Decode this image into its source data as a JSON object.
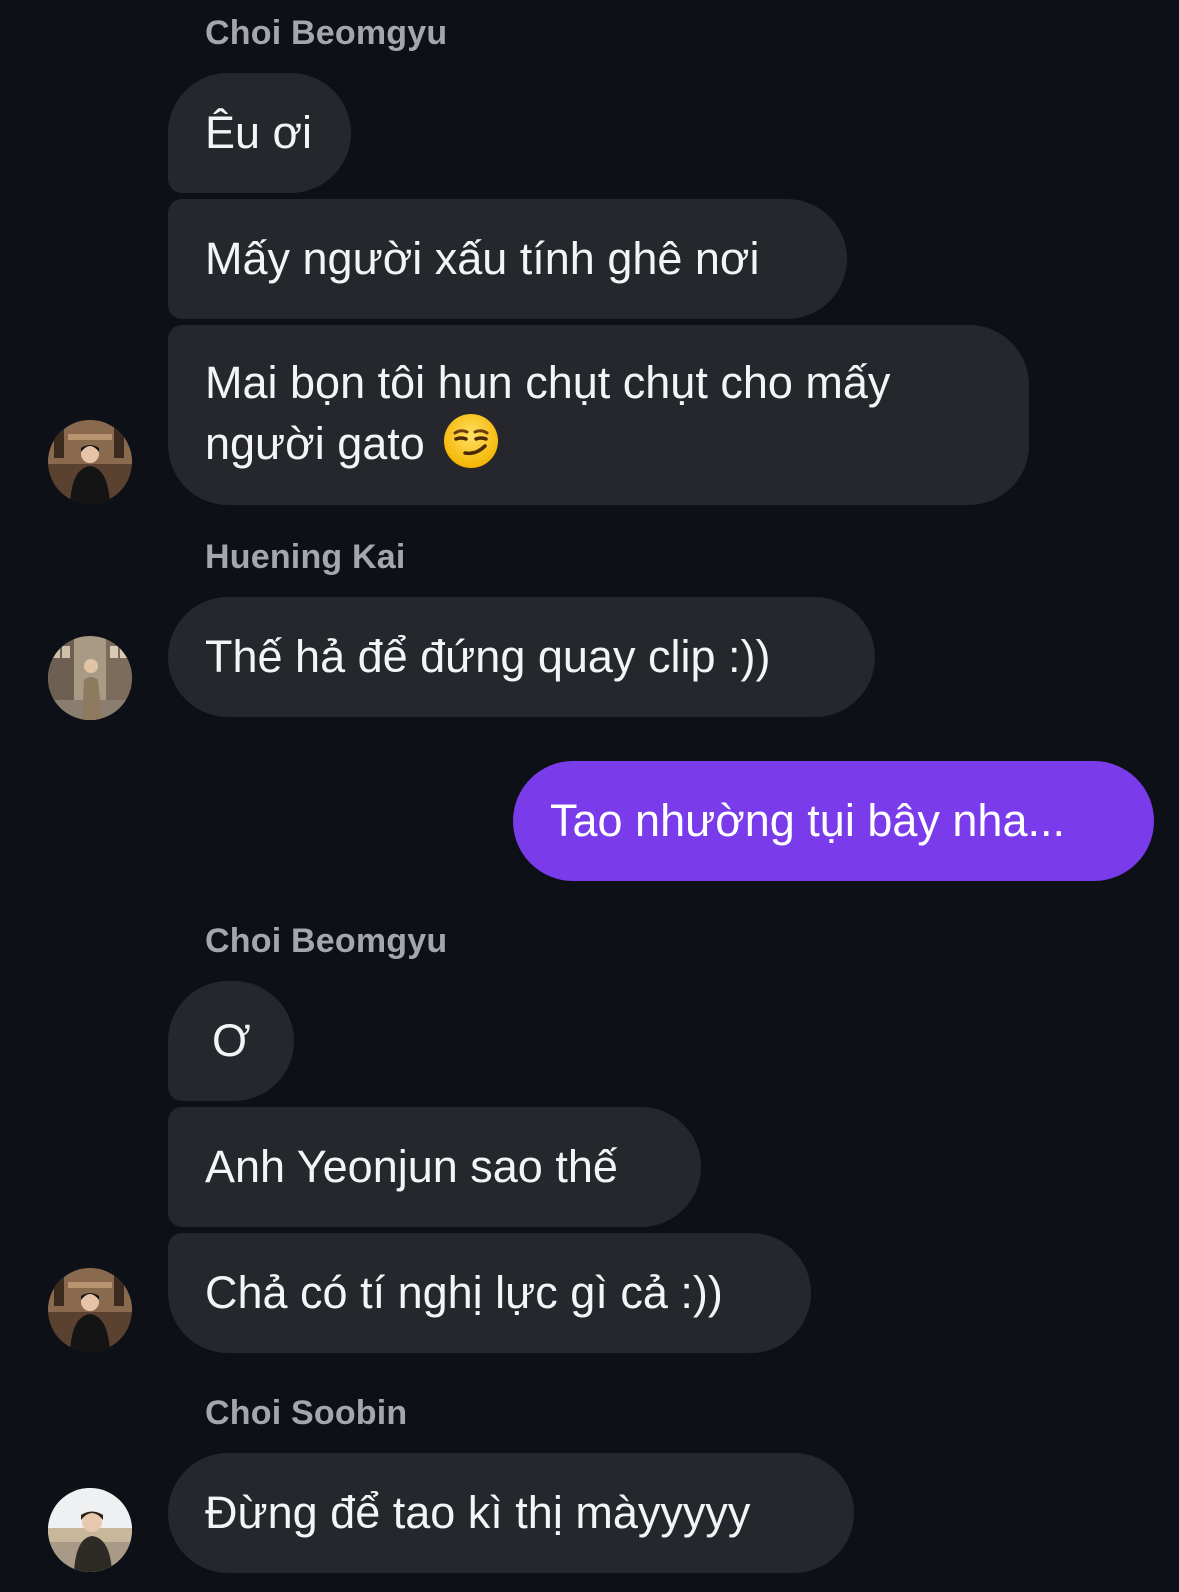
{
  "messages": [
    {
      "sender": "Choi Beomgyu",
      "lines": [
        "Êu ơi",
        "Mấy người xấu tính ghê nơi",
        "Mai bọn tôi hun chụt chụt cho mấy người gato"
      ],
      "emoji": "smirking-face-emoji"
    },
    {
      "sender": "Huening Kai",
      "lines": [
        "Thế hả để đứng quay clip :))"
      ]
    },
    {
      "own": true,
      "lines": [
        "Tao nhường tụi bây nha..."
      ]
    },
    {
      "sender": "Choi Beomgyu",
      "lines": [
        "Ơ",
        "Anh Yeonjun sao thế",
        "Chả có tí nghị lực gì cả :))"
      ]
    },
    {
      "sender": "Choi Soobin",
      "lines": [
        "Đừng để tao kì thị màyyyyy"
      ]
    }
  ],
  "colors": {
    "background": "#0d1016",
    "incoming_bubble": "#25272d",
    "outgoing_bubble": "#7a3bea",
    "sender_name": "#a3a6ad",
    "text": "#f3f4f6"
  }
}
